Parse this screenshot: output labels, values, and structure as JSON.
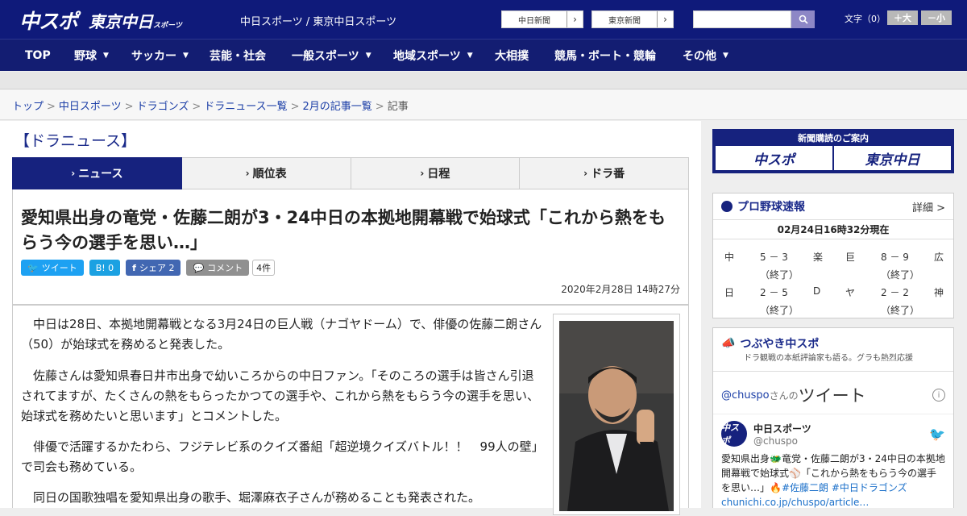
{
  "header": {
    "logo_chuspo": "中スポ",
    "logo_tokyo": "東京中日",
    "logo_tokyo_sub": "スポーツ",
    "site_name": "中日スポーツ / 東京中日スポーツ",
    "paper_buttons": [
      "中日新聞",
      "東京新聞"
    ],
    "font_label": "文字（0）",
    "font_bigger": "＋大",
    "font_smaller": "－小"
  },
  "nav": {
    "items": [
      "TOP",
      "野球",
      "サッカー",
      "芸能・社会",
      "一般スポーツ",
      "地域スポーツ",
      "大相撲",
      "競馬・ボート・競輪",
      "その他"
    ]
  },
  "breadcrumb": {
    "items": [
      "トップ",
      "中日スポーツ",
      "ドラゴンズ",
      "ドラニュース一覧",
      "2月の記事一覧"
    ],
    "current": "記事",
    "sep": ">"
  },
  "section": {
    "title": "【ドラニュース】",
    "tabs": [
      "ニュース",
      "順位表",
      "日程",
      "ドラ番"
    ]
  },
  "article": {
    "headline": "愛知県出身の竜党・佐藤二朗が3・24中日の本拠地開幕戦で始球式「これから熱をもらう今の選手を思い…」",
    "share": {
      "tweet": "ツイート",
      "hatena": "B! 0",
      "facebook": "シェア 2",
      "comment": "コメント",
      "comment_count": "4件"
    },
    "date": "2020年2月28日 14時27分",
    "paragraphs": [
      "中日は28日、本拠地開幕戦となる3月24日の巨人戦（ナゴヤドーム）で、俳優の佐藤二朗さん（50）が始球式を務めると発表した。",
      "佐藤さんは愛知県春日井市出身で幼いころからの中日ファン。「そのころの選手は皆さん引退されてますが、たくさんの熱をもらったかつての選手や、これから熱をもらう今の選手を思い、始球式を務めたいと思います」とコメントした。",
      "俳優で活躍するかたわら、フジテレビ系のクイズ番組「超逆境クイズバトル！！　99人の壁」で司会も務めている。",
      "同日の国歌独唱を愛知県出身の歌手、堀澤麻衣子さんが務めることも発表された。"
    ]
  },
  "sidebar": {
    "subscribe_title": "新聞購読のご案内",
    "subscribe_logos": [
      "中スポ",
      "東京中日"
    ],
    "baseball": {
      "title": "プロ野球速報",
      "more": "詳細 >",
      "updated": "02月24日16時32分現在",
      "games": [
        {
          "home": "中",
          "score": "5 － 3",
          "away": "楽",
          "status": "（終了）"
        },
        {
          "home": "巨",
          "score": "8 － 9",
          "away": "広",
          "status": "（終了）"
        },
        {
          "home": "日",
          "score": "2 － 5",
          "away": "D",
          "status": "（終了）"
        },
        {
          "home": "ヤ",
          "score": "2 － 2",
          "away": "神",
          "status": "（終了）"
        }
      ]
    },
    "tsubuyaki": {
      "title": "つぶやき中スポ",
      "subtitle": "ドラ観戦の本紙評論家も語る。グラも熱烈応援",
      "handle_line": "@chuspo",
      "handle_suffix": "さんの",
      "tweets_label": "ツイート",
      "tweet": {
        "avatar": "中スポ",
        "name": "中日スポーツ",
        "handle": "@chuspo",
        "text": "愛知県出身🐲竜党・佐藤二朗が3・24中日の本拠地開幕戦で始球式⚾「これから熱をもらう今の選手を思い…」🔥",
        "hashtags": "#佐藤二朗 #中日ドラゴンズ",
        "link": "chunichi.co.jp/chuspo/article…"
      }
    }
  },
  "colors": {
    "header": "#0f1a7a",
    "nav": "#131d72",
    "accent": "#16227e",
    "link": "#1a3da6"
  }
}
